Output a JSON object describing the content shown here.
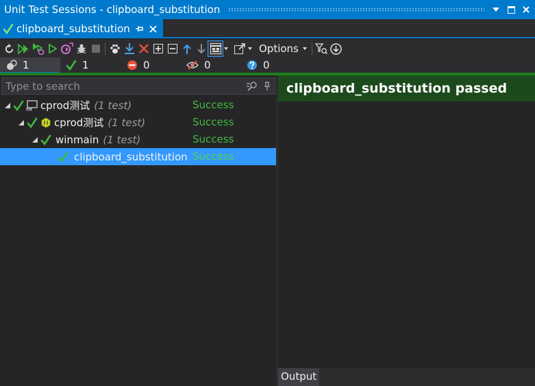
{
  "window": {
    "title": "Unit Test Sessions - clipboard_substitution"
  },
  "tab": {
    "label": "clipboard_substitution"
  },
  "toolbar": {
    "options_label": "Options"
  },
  "counters": [
    {
      "icon": "session-icon",
      "value": "1"
    },
    {
      "icon": "check-icon",
      "value": "1"
    },
    {
      "icon": "failed-icon",
      "value": "0"
    },
    {
      "icon": "ignored-icon",
      "value": "0"
    },
    {
      "icon": "unknown-icon",
      "value": "0"
    }
  ],
  "search": {
    "placeholder": "Type to search"
  },
  "tree": [
    {
      "name": "cprod测试",
      "count": "(1 test)",
      "status": "Success"
    },
    {
      "name": "cprod测试",
      "count": "(1 test)",
      "status": "Success"
    },
    {
      "name": "winmain",
      "count": "(1 test)",
      "status": "Success"
    },
    {
      "name": "clipboard_substitution",
      "count": "",
      "status": "Success"
    }
  ],
  "result": {
    "header": "clipboard_substitution passed"
  },
  "output": {
    "tab_label": "Output"
  },
  "colors": {
    "accent": "#007acc",
    "success": "#3fb83f",
    "selection": "#3399ff",
    "passed_header": "#1c4a1c"
  }
}
